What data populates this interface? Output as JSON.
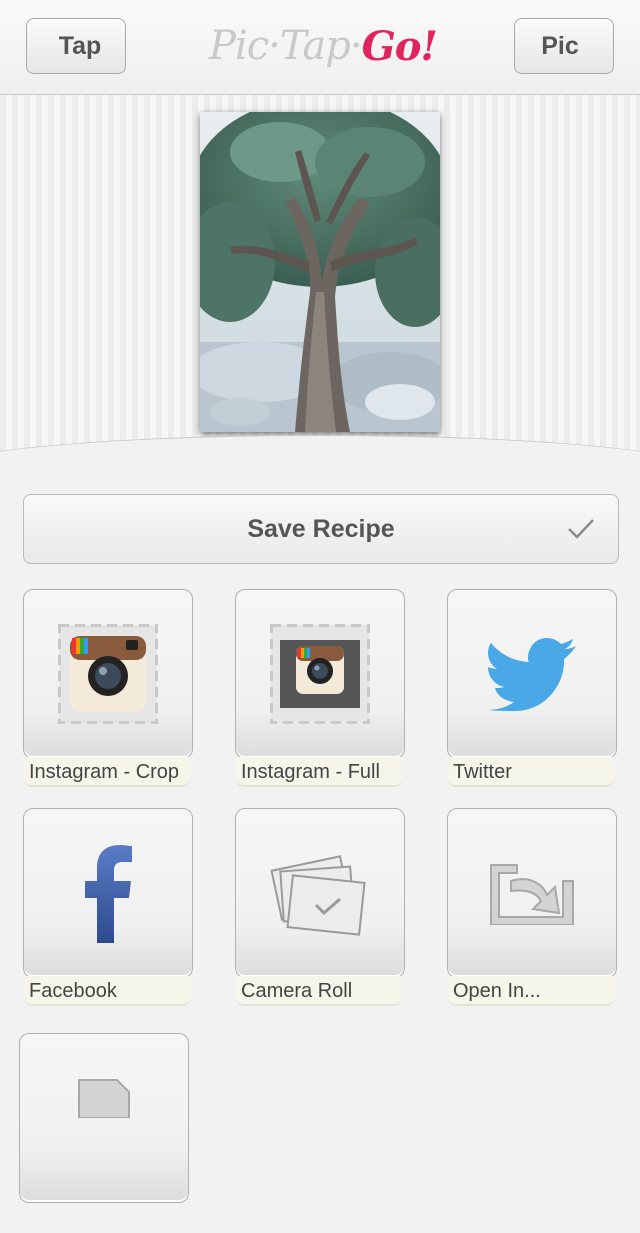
{
  "nav": {
    "back_label": "Tap",
    "forward_label": "Pic",
    "logo_part1": "Pic·Tap·",
    "logo_part2": "Go!"
  },
  "save_recipe": {
    "label": "Save Recipe",
    "icon": "checkmark-icon"
  },
  "share_targets": [
    {
      "label": "Instagram - Crop",
      "icon": "instagram-crop-icon"
    },
    {
      "label": "Instagram - Full",
      "icon": "instagram-full-icon"
    },
    {
      "label": "Twitter",
      "icon": "twitter-icon"
    },
    {
      "label": "Facebook",
      "icon": "facebook-icon"
    },
    {
      "label": "Camera Roll",
      "icon": "camera-roll-icon"
    },
    {
      "label": "Open In...",
      "icon": "open-in-icon"
    },
    {
      "label": "",
      "icon": "document-icon"
    }
  ],
  "colors": {
    "logo_accent": "#e0245e",
    "twitter_blue": "#4aa8e6",
    "facebook_blue": "#3b5998"
  }
}
